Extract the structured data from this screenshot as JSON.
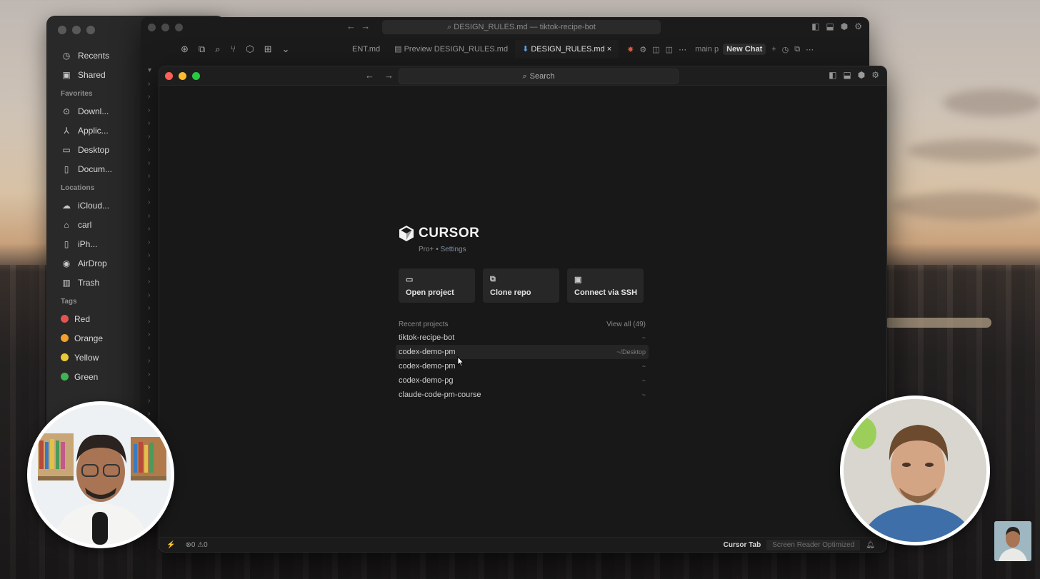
{
  "finder": {
    "recents": "Recents",
    "shared": "Shared",
    "favorites_label": "Favorites",
    "favorites": [
      "Downl...",
      "Applic...",
      "Desktop",
      "Docum..."
    ],
    "locations_label": "Locations",
    "locations": [
      "iCloud...",
      "carl",
      "iPh...",
      "AirDrop",
      "Trash"
    ],
    "tags_label": "Tags",
    "tags": [
      {
        "label": "Red",
        "color": "#e5524f"
      },
      {
        "label": "Orange",
        "color": "#f0a02e"
      },
      {
        "label": "Yellow",
        "color": "#e8c93a"
      },
      {
        "label": "Green",
        "color": "#3fb452"
      }
    ]
  },
  "back_editor": {
    "title": "DESIGN_RULES.md — tiktok-recipe-bot",
    "tabs": [
      "ENT.md",
      "Preview DESIGN_RULES.md",
      "DESIGN_RULES.md"
    ],
    "active_tab": "DESIGN_RULES.md",
    "close_glyph": "×",
    "branch": "main p",
    "new_chat": "New Chat"
  },
  "front": {
    "search_placeholder": "Search",
    "brand": "CURSOR",
    "plan": "Pro+",
    "separator": "•",
    "settings_link": "Settings",
    "actions": {
      "open_project": "Open project",
      "clone_repo": "Clone repo",
      "connect_ssh": "Connect via SSH"
    },
    "recent_label": "Recent projects",
    "view_all": "View all (49)",
    "projects": [
      {
        "name": "tiktok-recipe-bot",
        "path": "~"
      },
      {
        "name": "codex-demo-pm",
        "path": "~/Desktop"
      },
      {
        "name": "codex-demo-pm",
        "path": "~"
      },
      {
        "name": "codex-demo-pg",
        "path": "~"
      },
      {
        "name": "claude-code-pm-course",
        "path": "~"
      }
    ],
    "status": {
      "errors": "0",
      "warnings": "0",
      "cursor_tab": "Cursor Tab",
      "screen_reader": "Screen Reader Optimized"
    }
  },
  "colors": {
    "traffic_red": "#fe5f57",
    "traffic_yellow": "#febc2e",
    "traffic_green": "#28c840"
  }
}
